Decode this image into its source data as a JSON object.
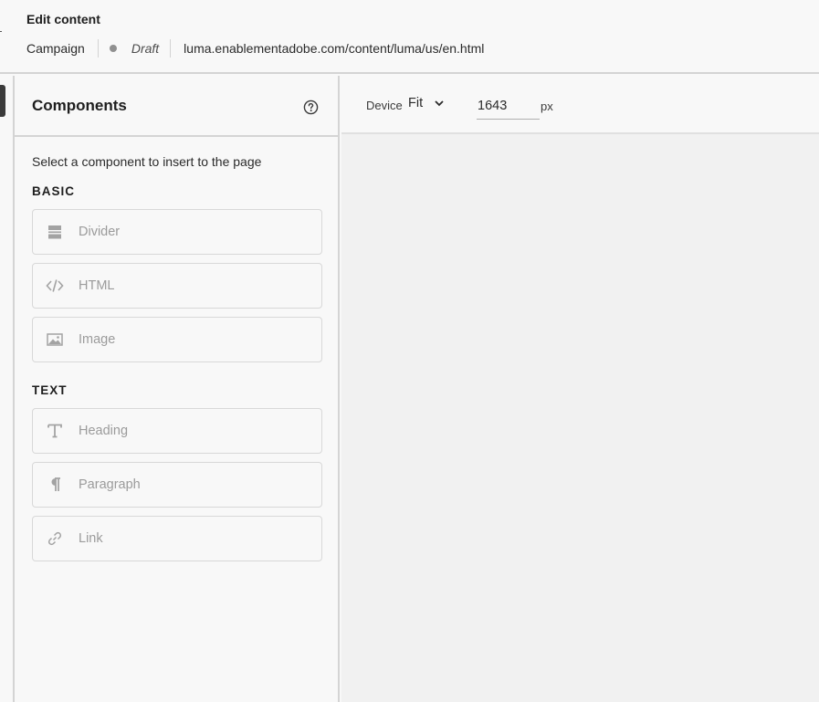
{
  "header": {
    "title": "Edit content",
    "campaign": "Campaign",
    "status": "Draft",
    "url": "luma.enablementadobe.com/content/luma/us/en.html"
  },
  "panel": {
    "title": "Components",
    "hint": "Select a component to insert to the page",
    "sections": [
      {
        "label": "BASIC",
        "items": [
          {
            "label": "Divider",
            "icon": "divider-icon"
          },
          {
            "label": "HTML",
            "icon": "code-icon"
          },
          {
            "label": "Image",
            "icon": "image-icon"
          }
        ]
      },
      {
        "label": "TEXT",
        "items": [
          {
            "label": "Heading",
            "icon": "heading-icon"
          },
          {
            "label": "Paragraph",
            "icon": "paragraph-icon"
          },
          {
            "label": "Link",
            "icon": "link-icon"
          }
        ]
      }
    ]
  },
  "toolbar": {
    "device_label": "Device",
    "device_value": "Fit",
    "width_value": "1643",
    "unit": "px"
  },
  "colors": {
    "border": "#d4d4d4",
    "muted_text": "#9b9b9b",
    "canvas_bg": "#f1f1f1"
  }
}
